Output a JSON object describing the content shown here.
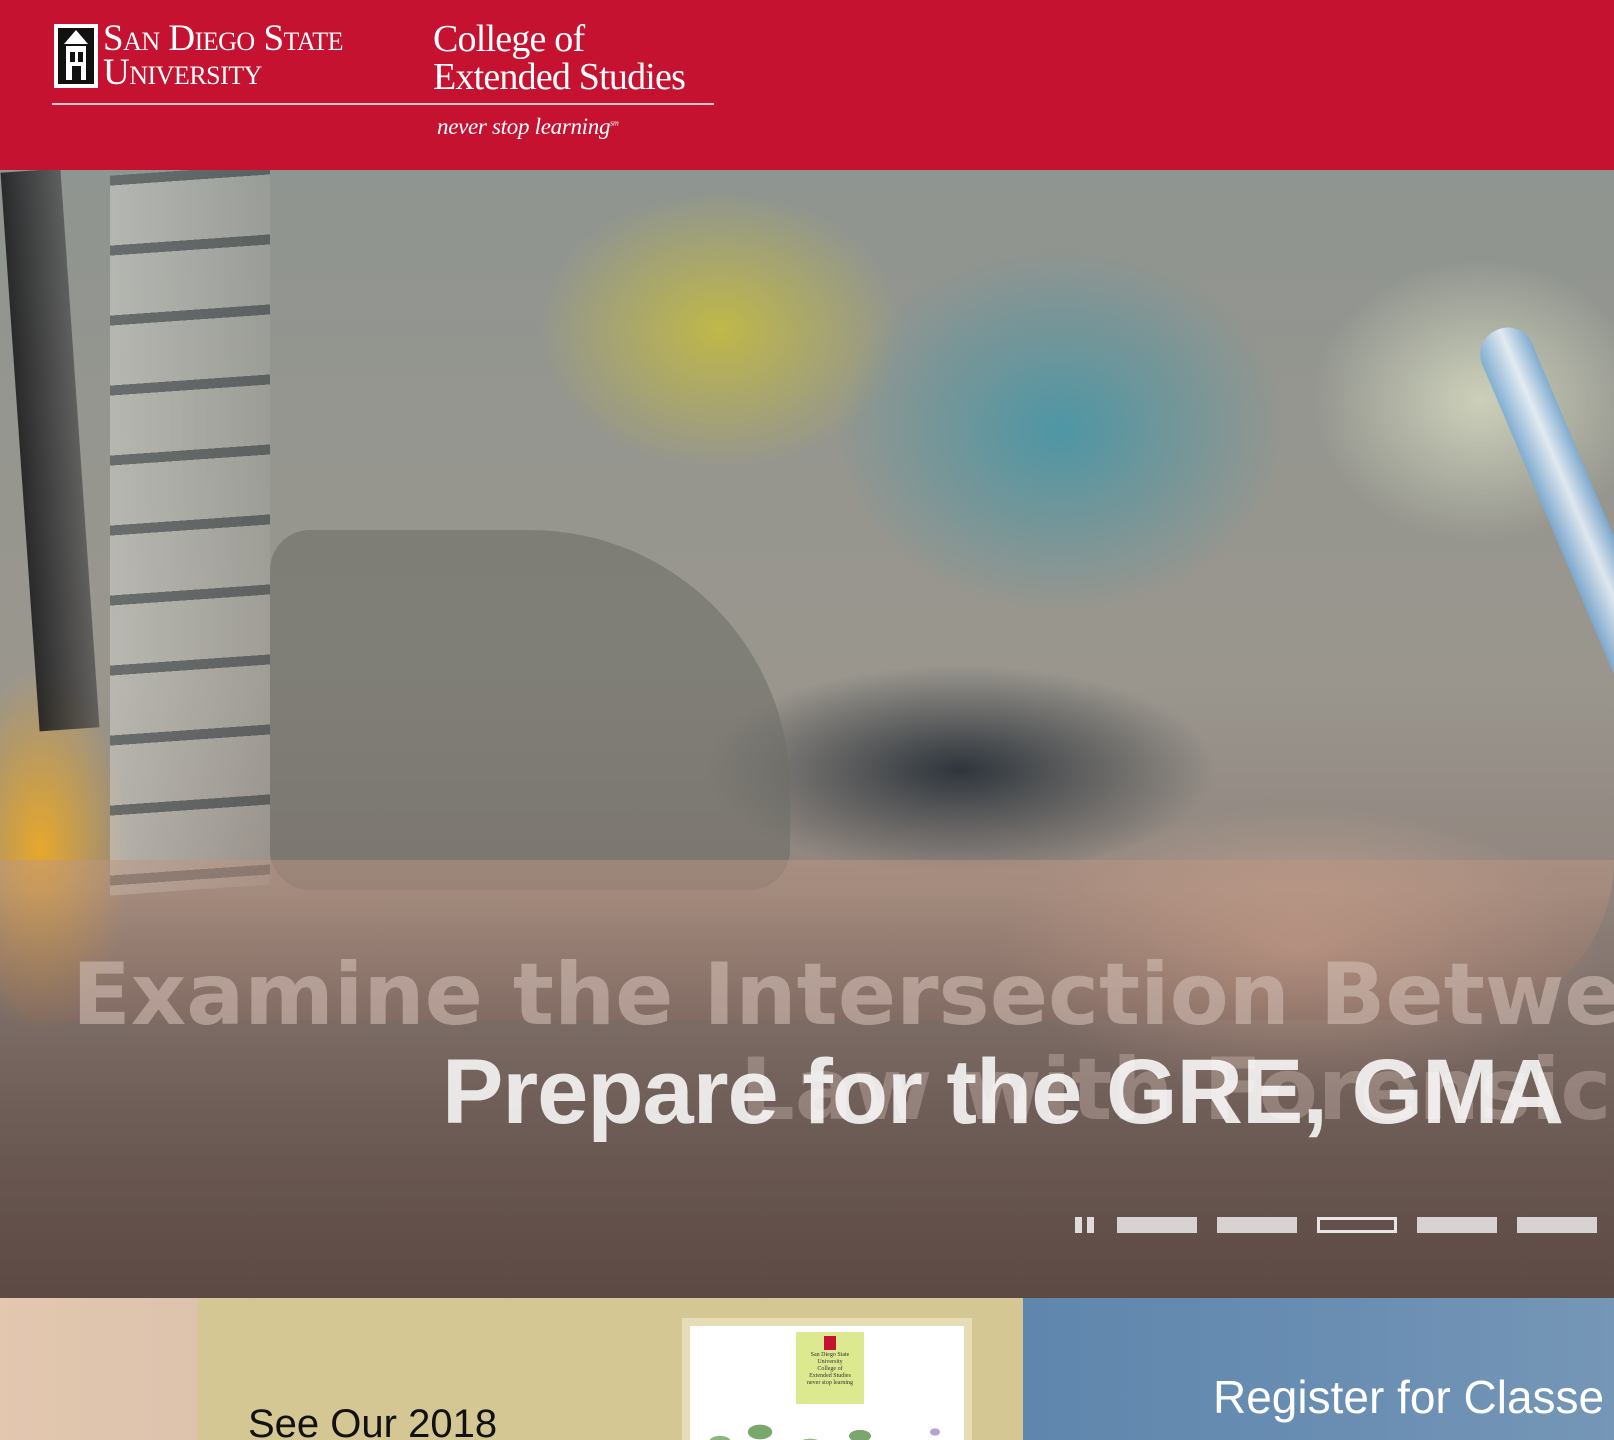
{
  "header": {
    "university_line1": "San Diego State",
    "university_line2": "University",
    "college_line1": "College of",
    "college_line2": "Extended Studies",
    "tagline": "never stop learning",
    "tagline_mark": "sm",
    "brand_color": "#c41230"
  },
  "hero": {
    "headline_ghost": "Examine the Intersection Between",
    "headline_ghost_2": "Law with Forensic",
    "headline": "Prepare for the GRE, GMA",
    "slider": {
      "pause_icon": "pause-icon",
      "dot_count": 6,
      "active_index": 2
    }
  },
  "promos": {
    "catalog": {
      "text": "See Our 2018",
      "cover_university_line1": "San Diego State",
      "cover_university_line2": "University",
      "cover_college_line1": "College of",
      "cover_college_line2": "Extended Studies",
      "cover_tagline": "never stop learning"
    },
    "register": {
      "text": "Register for Classe"
    }
  }
}
